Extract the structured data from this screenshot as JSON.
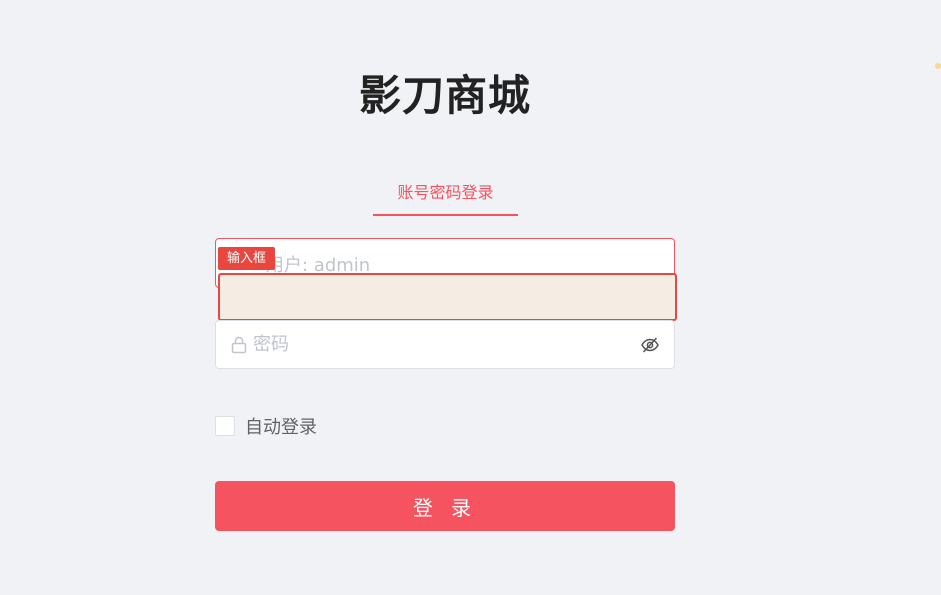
{
  "app": {
    "title": "影刀商城"
  },
  "tabs": [
    {
      "label": "账号密码登录",
      "active": true
    }
  ],
  "form": {
    "username": {
      "value": "",
      "placeholder": "用户: admin"
    },
    "password": {
      "value": "",
      "placeholder": "密码"
    },
    "remember_label": "自动登录",
    "remember_checked": false,
    "submit_label": "登 录"
  },
  "annotation": {
    "tag": "输入框"
  },
  "icons": {
    "password_prefix": "lock-icon",
    "password_suffix": "eye-off-icon"
  },
  "colors": {
    "accent": "#f5535f",
    "background": "#f0f2f5",
    "annotation": "#e8473f"
  }
}
